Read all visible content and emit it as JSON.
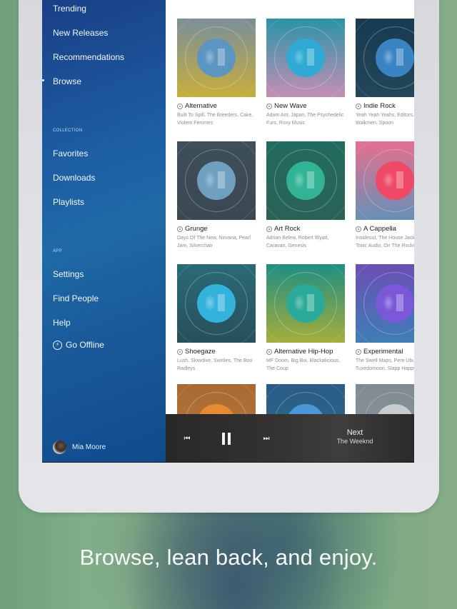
{
  "sidebar": {
    "nav_top": [
      {
        "label": "Trending"
      },
      {
        "label": "New Releases"
      },
      {
        "label": "Recommendations"
      },
      {
        "label": "Browse",
        "active": true
      }
    ],
    "collection_label": "COLLECTION",
    "collection": [
      {
        "label": "Favorites"
      },
      {
        "label": "Downloads"
      },
      {
        "label": "Playlists"
      }
    ],
    "app_label": "APP",
    "app": [
      {
        "label": "Settings"
      },
      {
        "label": "Find People"
      },
      {
        "label": "Help"
      }
    ],
    "go_offline": {
      "label": "Go Offline",
      "icon": "lightning-bolt-icon"
    },
    "user": {
      "name": "Mia Moore"
    }
  },
  "genres": [
    {
      "title": "Alternative",
      "artists": "Built To Spill, The Breeders, Cake, Violent Femmes",
      "colors": [
        "#7a8f9a",
        "#c7ae3c"
      ],
      "disc": "#5d95c2"
    },
    {
      "title": "New Wave",
      "artists": "Adam Ant, Japan, The Psychedelic Furs, Roxy Music",
      "colors": [
        "#2a93a8",
        "#c68fb4"
      ],
      "disc": "#2eaad4"
    },
    {
      "title": "Indie Rock",
      "artists": "Yeah Yeah Yeahs, Editors, Walkmen, Spoon",
      "colors": [
        "#183b52",
        "#24465a"
      ],
      "disc": "#3b84c4"
    },
    {
      "title": "Grunge",
      "artists": "Days Of The New, Nirvana, Pearl Jam, Silverchair",
      "colors": [
        "#3f4f5a",
        "#3a4852"
      ],
      "disc": "#6fa0bf"
    },
    {
      "title": "Art Rock",
      "artists": "Adrian Belew, Robert Wyatt, Caravan, Genesis",
      "colors": [
        "#226b5e",
        "#2a6256"
      ],
      "disc": "#33b396"
    },
    {
      "title": "A Cappella",
      "artists": "Insideout, The House Jacks, Toxic Audio, On The Rocks",
      "colors": [
        "#e47090",
        "#6790b6"
      ],
      "disc": "#ef4966"
    },
    {
      "title": "Shoegaze",
      "artists": "Lush, Slowdive, Swirlies, The Boo Radleys",
      "colors": [
        "#2b6a78",
        "#27505b"
      ],
      "disc": "#33b3dc"
    },
    {
      "title": "Alternative Hip-Hop",
      "artists": "MF Doom, Big Boi, Blackalicious, The Coup",
      "colors": [
        "#1f8f82",
        "#a6ad3a"
      ],
      "disc": "#2aab9a"
    },
    {
      "title": "Experimental",
      "artists": "The Swell Maps, Pere Ubu, Tuxedomoon, Slapp Happy",
      "colors": [
        "#6a4fb4",
        "#3f7eb6"
      ],
      "disc": "#7a58d8"
    },
    {
      "colors": [
        "#a86a32",
        "#b57a3e"
      ],
      "disc": "#e88a30"
    },
    {
      "colors": [
        "#2a5c84",
        "#2e6a92"
      ],
      "disc": "#4a98d8"
    },
    {
      "colors": [
        "#7f8a92",
        "#8d969c"
      ],
      "disc": "#c9cccf"
    }
  ],
  "player": {
    "prev_icon": "previous-track-icon",
    "pause_icon": "pause-icon",
    "next_icon": "next-track-icon",
    "up_next_label": "Next",
    "up_next_artist": "The Weeknd"
  },
  "tagline": "Browse, lean back, and enjoy."
}
